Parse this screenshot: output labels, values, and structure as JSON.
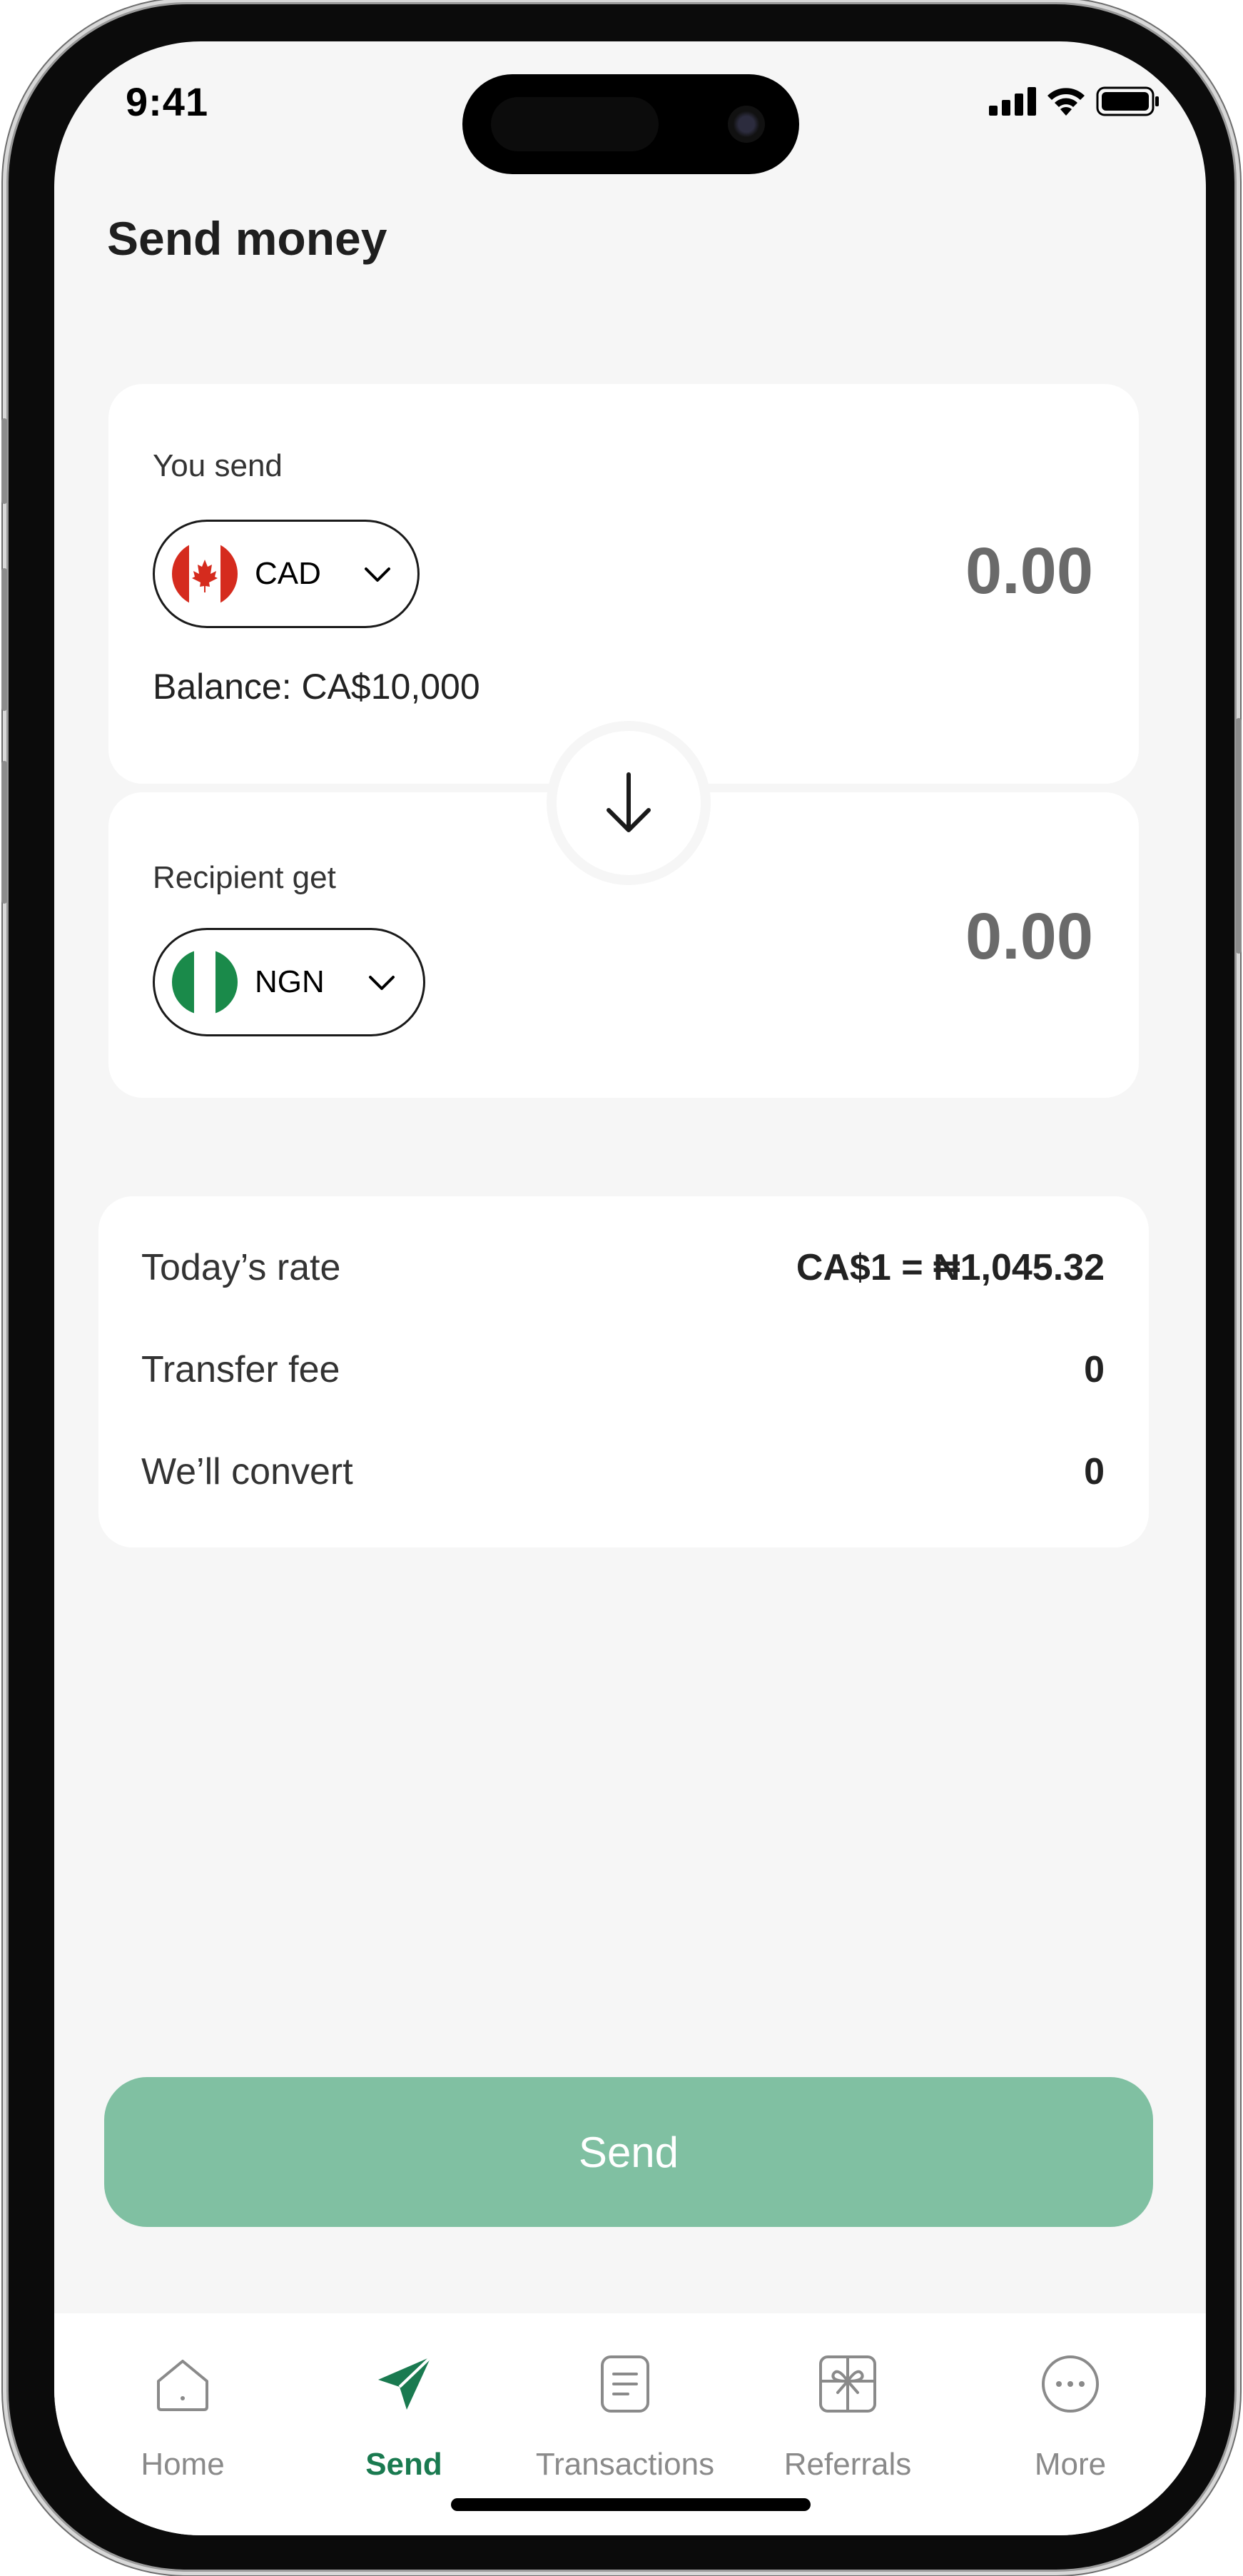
{
  "status_bar": {
    "time": "9:41"
  },
  "header": {
    "title": "Send money"
  },
  "send_card": {
    "label": "You send",
    "currency": "CAD",
    "amount": "0.00",
    "balance": "Balance: CA$10,000"
  },
  "receive_card": {
    "label": "Recipient get",
    "currency": "NGN",
    "amount": "0.00"
  },
  "rates": {
    "rows": [
      {
        "label": "Today’s rate",
        "value": "CA$1 = ₦1,045.32"
      },
      {
        "label": "Transfer fee",
        "value": "0"
      },
      {
        "label": "We’ll convert",
        "value": "0"
      }
    ]
  },
  "actions": {
    "send_label": "Send"
  },
  "tabbar": {
    "items": [
      {
        "label": "Home",
        "icon": "home-icon"
      },
      {
        "label": "Send",
        "icon": "send-icon",
        "active": true
      },
      {
        "label": "Transactions",
        "icon": "document-icon"
      },
      {
        "label": "Referrals",
        "icon": "gift-icon"
      },
      {
        "label": "More",
        "icon": "more-icon"
      }
    ]
  },
  "colors": {
    "accent": "#1a7a50",
    "send_button": "#80c0a2",
    "background": "#f6f6f6",
    "card": "#ffffff"
  }
}
